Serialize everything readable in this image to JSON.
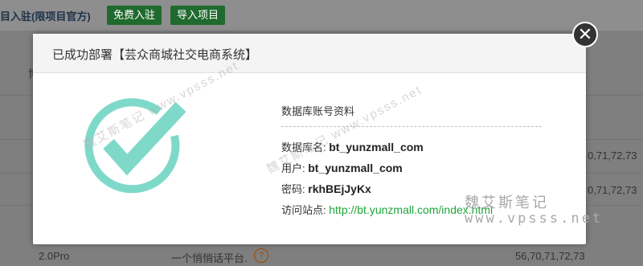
{
  "background": {
    "header_text": "目入驻(限项目官方)",
    "btn_free": "免费入驻",
    "btn_import": "导入项目",
    "col_partial": "博",
    "rows": [
      {
        "right_text": "0,71,72,73"
      },
      {
        "right_text": "0,71,72,73"
      }
    ],
    "last_row": {
      "version": "2.0Pro",
      "desc": "一个悄悄话平台.",
      "help": "?",
      "codes": "56,70,71,72,73"
    }
  },
  "modal": {
    "title": "已成功部署【芸众商城社交电商系统】",
    "close_glyph": "✕",
    "section_heading": "数据库账号资料",
    "db_name_label": "数据库名:",
    "db_name_value": "bt_yunzmall_com",
    "user_label": "用户:",
    "user_value": "bt_yunzmall_com",
    "password_label": "密码:",
    "password_value": "rkhBEjJyKx",
    "site_label": "访问站点:",
    "site_url": "http://bt.yunzmall.com/index.html",
    "check_color": "#7fd9c9"
  },
  "watermarks": {
    "cn": "魏艾斯笔记",
    "url": "www.vpsss.net"
  }
}
